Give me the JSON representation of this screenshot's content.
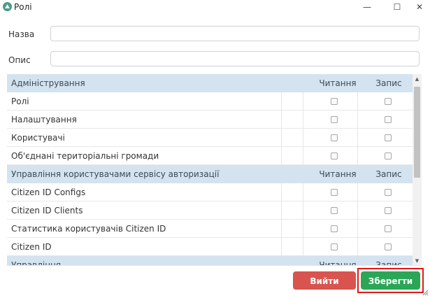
{
  "window": {
    "title": "Ролі",
    "minimize_glyph": "—",
    "maximize_glyph": "☐",
    "close_glyph": "✕"
  },
  "form": {
    "name_label": "Назва",
    "name_value": "",
    "description_label": "Опис",
    "description_value": ""
  },
  "table": {
    "sections": [
      {
        "title": "Адміністрування",
        "read_header": "Читання",
        "write_header": "Запис",
        "rows": [
          {
            "label": "Ролі",
            "read": false,
            "write": false
          },
          {
            "label": "Налаштування",
            "read": false,
            "write": false
          },
          {
            "label": "Користувачі",
            "read": false,
            "write": false
          },
          {
            "label": "Об'єднані територіальні громади",
            "read": false,
            "write": false
          }
        ]
      },
      {
        "title": "Управління користувачами сервісу авторизації",
        "read_header": "Читання",
        "write_header": "Запис",
        "rows": [
          {
            "label": "Citizen ID Configs",
            "read": false,
            "write": false
          },
          {
            "label": "Citizen ID Clients",
            "read": false,
            "write": false
          },
          {
            "label": "Статистика користувачів Citizen ID",
            "read": false,
            "write": false
          },
          {
            "label": "Citizen ID",
            "read": false,
            "write": false
          }
        ]
      },
      {
        "title": "Управління",
        "read_header": "Читання",
        "write_header": "Запис",
        "rows": []
      }
    ]
  },
  "buttons": {
    "exit_label": "Вийти",
    "save_label": "Зберегти"
  },
  "colors": {
    "section_header_bg": "#d3e3ef",
    "exit_button": "#d9534f",
    "save_button": "#2aa656",
    "highlight_border": "#e01919"
  }
}
